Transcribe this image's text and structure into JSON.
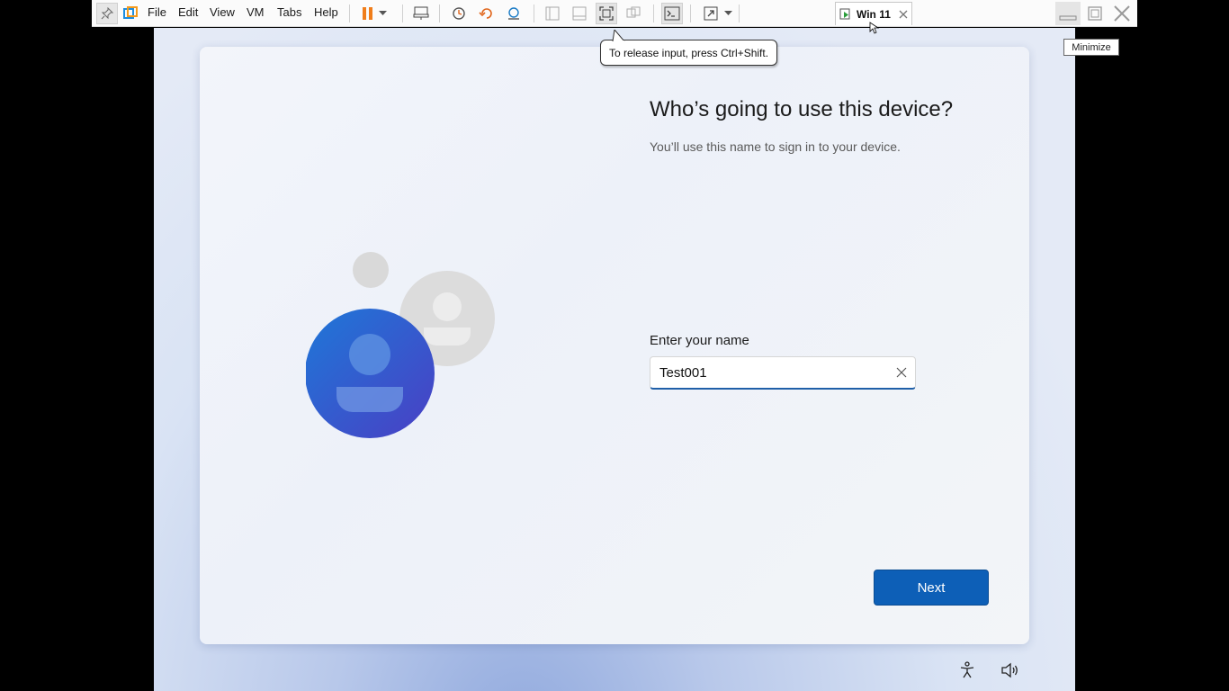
{
  "toolbar": {
    "menus": [
      "File",
      "Edit",
      "View",
      "VM",
      "Tabs",
      "Help"
    ],
    "vm_tab_label": "Win 11"
  },
  "tooltips": {
    "release_input": "To release input, press Ctrl+Shift.",
    "minimize": "Minimize"
  },
  "setup": {
    "heading": "Who’s going to use this device?",
    "subtitle": "You’ll use this name to sign in to your device.",
    "name_label": "Enter your name",
    "name_value": "Test001",
    "next_label": "Next"
  },
  "colors": {
    "accent": "#0d5fb7",
    "pause_orange": "#f07d1a"
  }
}
